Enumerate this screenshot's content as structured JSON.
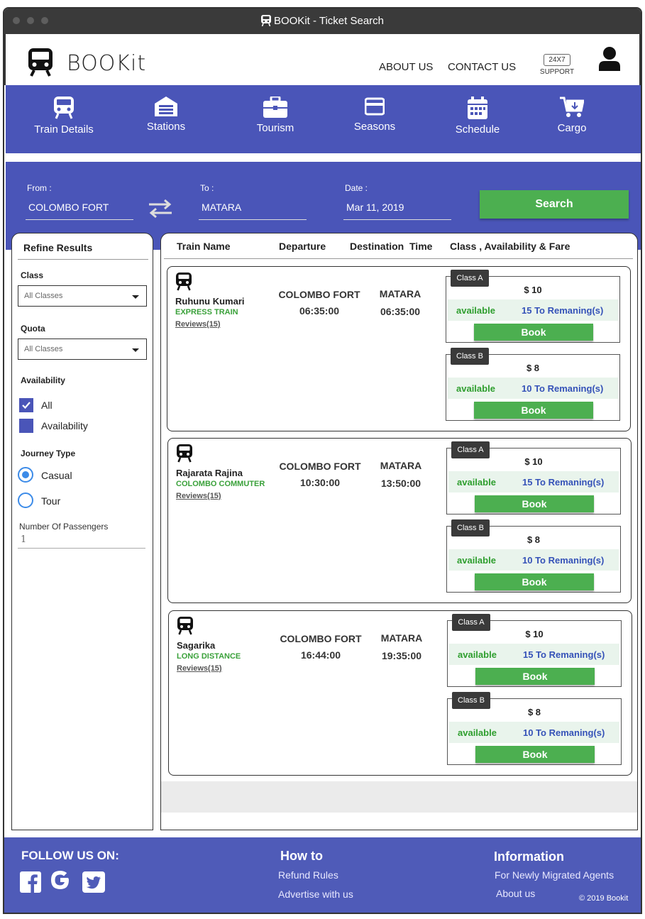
{
  "window": {
    "title": "BOOKit - Ticket Search"
  },
  "header": {
    "brand": "BOOKit",
    "links": {
      "about": "ABOUT US",
      "contact": "CONTACT US"
    },
    "support_badge": "24X7",
    "support_label": "SUPPORT"
  },
  "nav": {
    "items": [
      {
        "label": "Train Details"
      },
      {
        "label": "Stations"
      },
      {
        "label": "Tourism"
      },
      {
        "label": "Seasons"
      },
      {
        "label": "Schedule"
      },
      {
        "label": "Cargo"
      }
    ]
  },
  "search": {
    "from_label": "From :",
    "from_value": "COLOMBO FORT",
    "to_label": "To :",
    "to_value": "MATARA",
    "date_label": "Date :",
    "date_value": "Mar 11, 2019",
    "button": "Search"
  },
  "refine": {
    "title": "Refine Results",
    "class_label": "Class",
    "class_value": "All Classes",
    "quota_label": "Quota",
    "quota_value": "All Classes",
    "availability_label": "Availability",
    "availability_options": [
      {
        "label": "All",
        "checked": true
      },
      {
        "label": "Availability",
        "checked": false
      }
    ],
    "journey_label": "Journey Type",
    "journey_options": [
      {
        "label": "Casual",
        "selected": true
      },
      {
        "label": "Tour",
        "selected": false
      }
    ],
    "passengers_label": "Number Of Passengers",
    "passengers_value": "1"
  },
  "results": {
    "headers": {
      "train_name": "Train Name",
      "departure": "Departure",
      "destination": "Destination  Time",
      "class": "Class , Availability & Fare"
    },
    "trains": [
      {
        "name": "Ruhunu Kumari",
        "type": "EXPRESS TRAIN",
        "reviews": "Reviews(15)",
        "dep_station": "COLOMBO FORT",
        "dep_time": "06:35:00",
        "dest_station": "MATARA",
        "dest_time": "06:35:00",
        "classes": [
          {
            "tag": "Class A",
            "fare": "$ 10",
            "status": "available",
            "remaining": "15 To Remaning(s)",
            "book": "Book"
          },
          {
            "tag": "Class B",
            "fare": "$ 8",
            "status": "available",
            "remaining": "10 To Remaning(s)",
            "book": "Book"
          }
        ]
      },
      {
        "name": "Rajarata Rajina",
        "type": "COLOMBO COMMUTER",
        "reviews": "Reviews(15)",
        "dep_station": "COLOMBO FORT",
        "dep_time": "10:30:00",
        "dest_station": "MATARA",
        "dest_time": "13:50:00",
        "classes": [
          {
            "tag": "Class A",
            "fare": "$ 10",
            "status": "available",
            "remaining": "15 To Remaning(s)",
            "book": "Book"
          },
          {
            "tag": "Class B",
            "fare": "$ 8",
            "status": "available",
            "remaining": "10 To Remaning(s)",
            "book": "Book"
          }
        ]
      },
      {
        "name": "Sagarika",
        "type": "LONG DISTANCE",
        "reviews": "Reviews(15)",
        "dep_station": "COLOMBO FORT",
        "dep_time": "16:44:00",
        "dest_station": "MATARA",
        "dest_time": "19:35:00",
        "classes": [
          {
            "tag": "Class A",
            "fare": "$ 10",
            "status": "available",
            "remaining": "15 To Remaning(s)",
            "book": "Book"
          },
          {
            "tag": "Class B",
            "fare": "$ 8",
            "status": "available",
            "remaining": "10 To Remaning(s)",
            "book": "Book"
          }
        ]
      }
    ]
  },
  "footer": {
    "follow_title": "FOLLOW US ON:",
    "social": [
      "facebook-icon",
      "google-icon",
      "twitter-icon"
    ],
    "howto_title": "How to",
    "howto_links": [
      "Refund Rules",
      "Advertise with us"
    ],
    "info_title": "Information",
    "info_links": [
      "For Newly Migrated Agents",
      "About us"
    ],
    "copyright": "© 2019 Bookit"
  },
  "colors": {
    "primary": "#4a55b8",
    "accent": "#4caf50",
    "remaining_text": "#3552b8",
    "available_text": "#2e9e2e"
  }
}
